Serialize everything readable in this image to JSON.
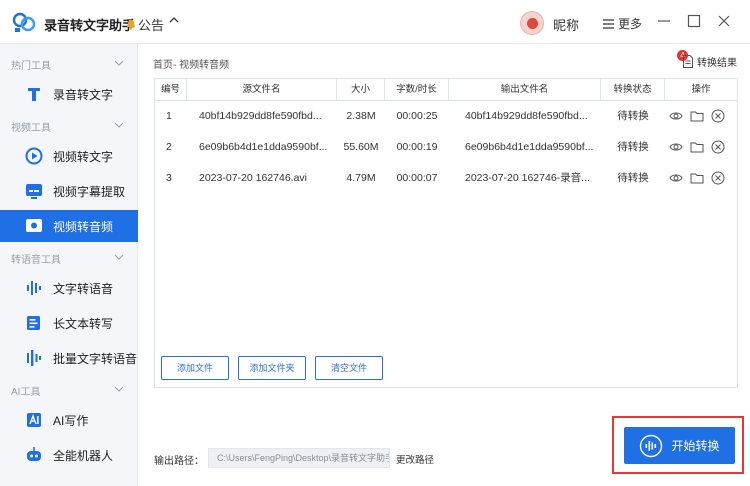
{
  "app": {
    "title": "录音转文字助手",
    "announcement": "公告",
    "nickname": "昵称",
    "more": "更多"
  },
  "sidebar": {
    "groups": [
      {
        "label": "热门工具",
        "items": [
          {
            "label": "录音转文字",
            "icon": "t-text-icon"
          }
        ]
      },
      {
        "label": "视频工具",
        "items": [
          {
            "label": "视频转文字",
            "icon": "video-play-icon"
          },
          {
            "label": "视频字幕提取",
            "icon": "subtitle-icon"
          },
          {
            "label": "视频转音频",
            "icon": "video-audio-icon",
            "active": true
          }
        ]
      },
      {
        "label": "转语音工具",
        "items": [
          {
            "label": "文字转语音",
            "icon": "soundwave-icon"
          },
          {
            "label": "长文本转写",
            "icon": "long-text-icon"
          },
          {
            "label": "批量文字转语音",
            "icon": "batch-voice-icon"
          }
        ]
      },
      {
        "label": "AI工具",
        "items": [
          {
            "label": "AI写作",
            "icon": "ai-write-icon"
          },
          {
            "label": "全能机器人",
            "icon": "robot-icon"
          }
        ]
      }
    ]
  },
  "main": {
    "breadcrumb": "首页- 视频转音频",
    "result_label": "转换结果",
    "result_count": "4",
    "columns": [
      "编号",
      "源文件名",
      "大小",
      "字数/时长",
      "输出文件名",
      "转换状态",
      "操作"
    ],
    "rows": [
      {
        "no": "1",
        "src": "40bf14b929dd8fe590fbd...",
        "size": "2.38M",
        "dur": "00:00:25",
        "out": "40bf14b929dd8fe590fbd...",
        "status": "待转换"
      },
      {
        "no": "2",
        "src": "6e09b6b4d1e1dda9590bf...",
        "size": "55.60M",
        "dur": "00:00:19",
        "out": "6e09b6b4d1e1dda9590bf...",
        "status": "待转换"
      },
      {
        "no": "3",
        "src": "2023-07-20 162746.avi",
        "size": "4.79M",
        "dur": "00:00:07",
        "out": "2023-07-20 162746-录音...",
        "status": "待转换"
      }
    ],
    "buttons": {
      "add_file": "添加文件",
      "add_folder": "添加文件夹",
      "clear": "清空文件"
    },
    "output_label": "输出路径：",
    "output_path": "C:\\Users\\FengPing\\Desktop\\录音转文字助手",
    "change_path": "更改路径",
    "start": "开始转换"
  },
  "colors": {
    "accent": "#1f6fe5",
    "highlight": "#e53935",
    "sidebar_bg": "#f4f6fa"
  }
}
